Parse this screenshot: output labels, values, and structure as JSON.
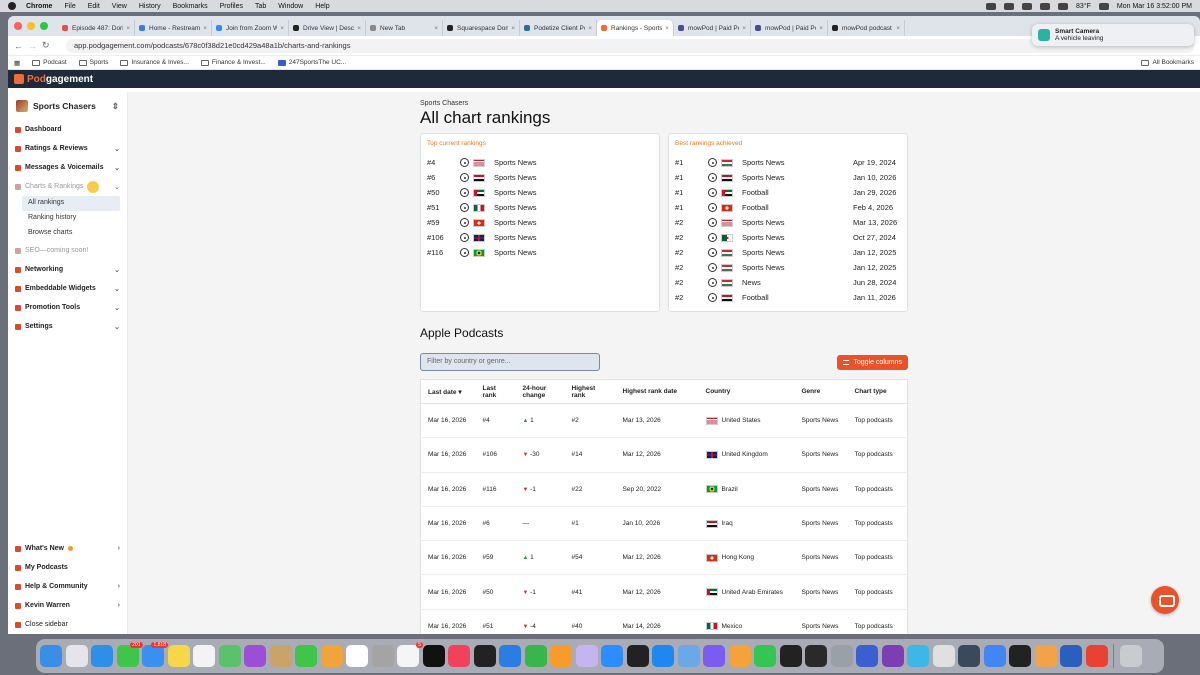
{
  "menubar": {
    "app": "Chrome",
    "items": [
      "File",
      "Edit",
      "View",
      "History",
      "Bookmarks",
      "Profiles",
      "Tab",
      "Window",
      "Help"
    ],
    "weather": "83°F",
    "datetime": "Mon Mar 16  3:52:00 PM"
  },
  "notification": {
    "title": "Smart Camera",
    "body": "A vehicle leaving"
  },
  "tabs": [
    {
      "label": "Episode 487: Doriar",
      "color": "#e0524a"
    },
    {
      "label": "Home - Restream",
      "color": "#3b7de0"
    },
    {
      "label": "Join from Zoom Wo",
      "color": "#2d8cff"
    },
    {
      "label": "Drive View | Descript",
      "color": "#222"
    },
    {
      "label": "New Tab",
      "color": "#888"
    },
    {
      "label": "Squarespace Doma",
      "color": "#222"
    },
    {
      "label": "Podetize Client Port",
      "color": "#2b6ca3"
    },
    {
      "label": "Rankings - Sports C",
      "color": "#f26b3a"
    },
    {
      "label": "mowPod | Paid Podc",
      "color": "#4a4a9a"
    },
    {
      "label": "mowPod | Paid Podc",
      "color": "#4a4a9a"
    },
    {
      "label": "mowPod podcast ch",
      "color": "#222"
    }
  ],
  "url": "app.podgagement.com/podcasts/678c0f38d21e0cd429a48a1b/charts-and-rankings",
  "bookmarks": [
    "Podcast",
    "Sports",
    "Insurance & Inves...",
    "Finance & Invest...",
    "247SportsThe UC..."
  ],
  "bookmarks_all": "All Bookmarks",
  "brand": {
    "pre": "Pod",
    "post": "gagement"
  },
  "sidebar": {
    "show_name": "Sports Chasers",
    "items": {
      "dashboard": "Dashboard",
      "ratings": "Ratings & Reviews",
      "messages": "Messages & Voicemails",
      "charts": "Charts & Rankings",
      "all_rankings": "All rankings",
      "ranking_history": "Ranking history",
      "browse_charts": "Browse charts",
      "seo": "SEO—coming soon!",
      "networking": "Networking",
      "widgets": "Embeddable Widgets",
      "promotion": "Promotion Tools",
      "settings": "Settings",
      "whats_new": "What's New",
      "my_podcasts": "My Podcasts",
      "help": "Help & Community",
      "user": "Kevin Warren",
      "close": "Close sidebar"
    }
  },
  "page": {
    "kicker": "Sports Chasers",
    "title": "All chart rankings",
    "top_current_title": "Top current rankings",
    "best_title": "Best rankings achieved",
    "section_title": "Apple Podcasts",
    "filter_placeholder": "Filter by country or genre...",
    "toggle_label": "Toggle columns"
  },
  "top_current": [
    {
      "rank": "#4",
      "genre": "Sports News",
      "flag": "us"
    },
    {
      "rank": "#6",
      "genre": "Sports News",
      "flag": "iq"
    },
    {
      "rank": "#50",
      "genre": "Sports News",
      "flag": "ae"
    },
    {
      "rank": "#51",
      "genre": "Sports News",
      "flag": "mx"
    },
    {
      "rank": "#59",
      "genre": "Sports News",
      "flag": "hk"
    },
    {
      "rank": "#106",
      "genre": "Sports News",
      "flag": "gb"
    },
    {
      "rank": "#116",
      "genre": "Sports News",
      "flag": "br"
    }
  ],
  "best": [
    {
      "rank": "#1",
      "genre": "Sports News",
      "date": "Apr 19, 2024",
      "flag": "hu"
    },
    {
      "rank": "#1",
      "genre": "Sports News",
      "date": "Jan 10, 2026",
      "flag": "iq"
    },
    {
      "rank": "#1",
      "genre": "Football",
      "date": "Jan 29, 2026",
      "flag": "ae"
    },
    {
      "rank": "#1",
      "genre": "Football",
      "date": "Feb 4, 2026",
      "flag": "hk"
    },
    {
      "rank": "#2",
      "genre": "Sports News",
      "date": "Mar 13, 2026",
      "flag": "us"
    },
    {
      "rank": "#2",
      "genre": "Sports News",
      "date": "Oct 27, 2024",
      "flag": "dz"
    },
    {
      "rank": "#2",
      "genre": "Sports News",
      "date": "Jan 12, 2025",
      "flag": "hu"
    },
    {
      "rank": "#2",
      "genre": "Sports News",
      "date": "Jan 12, 2025",
      "flag": "hu"
    },
    {
      "rank": "#2",
      "genre": "News",
      "date": "Jun 28, 2024",
      "flag": "hu"
    },
    {
      "rank": "#2",
      "genre": "Football",
      "date": "Jan 11, 2026",
      "flag": "eg"
    }
  ],
  "table": {
    "headers": {
      "last_date": "Last date",
      "last_rank": "Last rank",
      "change": "24-hour change",
      "highest_rank": "Highest rank",
      "highest_date": "Highest rank date",
      "country": "Country",
      "genre": "Genre",
      "chart_type": "Chart type"
    },
    "rows": [
      {
        "date": "Mar 16, 2026",
        "rank": "#4",
        "dir": "up",
        "change": "1",
        "high": "#2",
        "high_date": "Mar 13, 2026",
        "country": "United States",
        "flag": "us",
        "genre": "Sports News",
        "type": "Top podcasts"
      },
      {
        "date": "Mar 16, 2026",
        "rank": "#106",
        "dir": "down",
        "change": "-30",
        "high": "#14",
        "high_date": "Mar 12, 2026",
        "country": "United Kingdom",
        "flag": "gb",
        "genre": "Sports News",
        "type": "Top podcasts"
      },
      {
        "date": "Mar 16, 2026",
        "rank": "#116",
        "dir": "down",
        "change": "-1",
        "high": "#22",
        "high_date": "Sep 20, 2022",
        "country": "Brazil",
        "flag": "br",
        "genre": "Sports News",
        "type": "Top podcasts"
      },
      {
        "date": "Mar 16, 2026",
        "rank": "#6",
        "dir": "none",
        "change": "—",
        "high": "#1",
        "high_date": "Jan 10, 2026",
        "country": "Iraq",
        "flag": "iq",
        "genre": "Sports News",
        "type": "Top podcasts"
      },
      {
        "date": "Mar 16, 2026",
        "rank": "#59",
        "dir": "up",
        "change": "1",
        "high": "#54",
        "high_date": "Mar 12, 2026",
        "country": "Hong Kong",
        "flag": "hk",
        "genre": "Sports News",
        "type": "Top podcasts"
      },
      {
        "date": "Mar 16, 2026",
        "rank": "#50",
        "dir": "down",
        "change": "-1",
        "high": "#41",
        "high_date": "Mar 12, 2026",
        "country": "United Arab Emirates",
        "flag": "ae",
        "genre": "Sports News",
        "type": "Top podcasts"
      },
      {
        "date": "Mar 16, 2026",
        "rank": "#51",
        "dir": "down",
        "change": "-4",
        "high": "#40",
        "high_date": "Mar 14, 2026",
        "country": "Mexico",
        "flag": "mx",
        "genre": "Sports News",
        "type": "Top podcasts"
      }
    ]
  },
  "dock": [
    {
      "name": "finder",
      "color": "#3a8ee6"
    },
    {
      "name": "launchpad",
      "color": "#e4e4ea"
    },
    {
      "name": "safari",
      "color": "#2f8fe8"
    },
    {
      "name": "messages",
      "color": "#3ec54a",
      "badge": "201"
    },
    {
      "name": "mail",
      "color": "#3b8ff0",
      "badge": "1,818"
    },
    {
      "name": "notes",
      "color": "#f7d64a"
    },
    {
      "name": "freeform",
      "color": "#f3f3f3"
    },
    {
      "name": "maps",
      "color": "#5ac26a"
    },
    {
      "name": "podcasts",
      "color": "#9b4fd6"
    },
    {
      "name": "contacts",
      "color": "#c9a36a"
    },
    {
      "name": "facetime",
      "color": "#3ec54a"
    },
    {
      "name": "photos",
      "color": "#f2a33a"
    },
    {
      "name": "calendar",
      "color": "#ffffff"
    },
    {
      "name": "preview",
      "color": "#a4a4a4"
    },
    {
      "name": "reminders",
      "color": "#f5f5f5",
      "badge": "5"
    },
    {
      "name": "apple-tv",
      "color": "#111"
    },
    {
      "name": "music",
      "color": "#f2415a"
    },
    {
      "name": "tour-app",
      "color": "#222"
    },
    {
      "name": "keynote",
      "color": "#2a7de1"
    },
    {
      "name": "numbers",
      "color": "#39b54a"
    },
    {
      "name": "pages",
      "color": "#f79c2a"
    },
    {
      "name": "obs",
      "color": "#c4b4f0"
    },
    {
      "name": "zoom",
      "color": "#2d8cff"
    },
    {
      "name": "speedtest",
      "color": "#222"
    },
    {
      "name": "app-store",
      "color": "#1e88f0"
    },
    {
      "name": "finder-2",
      "color": "#6aa8e8"
    },
    {
      "name": "grid-app",
      "color": "#7b5cf0"
    },
    {
      "name": "pencil-app",
      "color": "#f4a23a"
    },
    {
      "name": "whatsapp",
      "color": "#35c553"
    },
    {
      "name": "photobooth",
      "color": "#222"
    },
    {
      "name": "voice-memos",
      "color": "#2a2a2a"
    },
    {
      "name": "settings",
      "color": "#9aa0a8"
    },
    {
      "name": "phone-mirror",
      "color": "#3a5fd0"
    },
    {
      "name": "onenote",
      "color": "#7b3fb3"
    },
    {
      "name": "xcode-like",
      "color": "#3cb7e8"
    },
    {
      "name": "screenshot",
      "color": "#e0e0e0"
    },
    {
      "name": "camera-app",
      "color": "#3b4a5a"
    },
    {
      "name": "chrome",
      "color": "#4285f4"
    },
    {
      "name": "activity-monitor",
      "color": "#222"
    },
    {
      "name": "pages-2",
      "color": "#f2a34a"
    },
    {
      "name": "word",
      "color": "#2b5fbd"
    },
    {
      "name": "chrome-2",
      "color": "#e94235"
    },
    {
      "name": "trash",
      "color": "#c8cbd0"
    }
  ]
}
